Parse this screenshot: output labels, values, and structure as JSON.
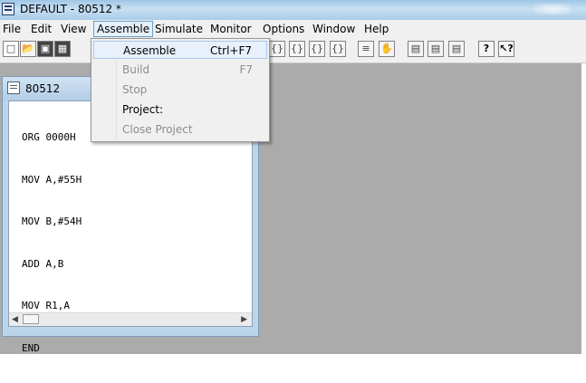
{
  "window": {
    "title": "DEFAULT - 80512 *"
  },
  "menubar": {
    "items": [
      "File",
      "Edit",
      "View",
      "Assemble",
      "Simulate",
      "Monitor",
      "Options",
      "Window",
      "Help"
    ]
  },
  "toolbar": {
    "buttons": [
      "new-file-icon",
      "open-folder-icon",
      "save-icon",
      "save-all-icon",
      "step-into-icon",
      "step-over-icon",
      "step-out-icon",
      "run-to-cursor-icon",
      "breakpoint-icon",
      "stop-hand-icon",
      "memory-window-icon",
      "register-window-icon",
      "watch-window-icon",
      "help-icon",
      "context-help-icon"
    ]
  },
  "assemble_menu": {
    "items": [
      {
        "label": "Assemble",
        "shortcut": "Ctrl+F7",
        "enabled": true
      },
      {
        "label": "Build",
        "shortcut": "F7",
        "enabled": false
      },
      {
        "label": "Stop",
        "shortcut": "",
        "enabled": false
      },
      {
        "label": "Project:",
        "shortcut": "",
        "enabled": true
      },
      {
        "label": "Close Project",
        "shortcut": "",
        "enabled": false
      }
    ]
  },
  "editor": {
    "title": "80512",
    "lines": [
      "ORG 0000H",
      "MOV A,#55H",
      "MOV B,#54H",
      "ADD A,B",
      "MOV R1,A",
      "END"
    ]
  },
  "colors": {
    "workspace": "#ababab",
    "disabled_text": "#8d8d8d",
    "highlight": "#e8f0fb"
  }
}
